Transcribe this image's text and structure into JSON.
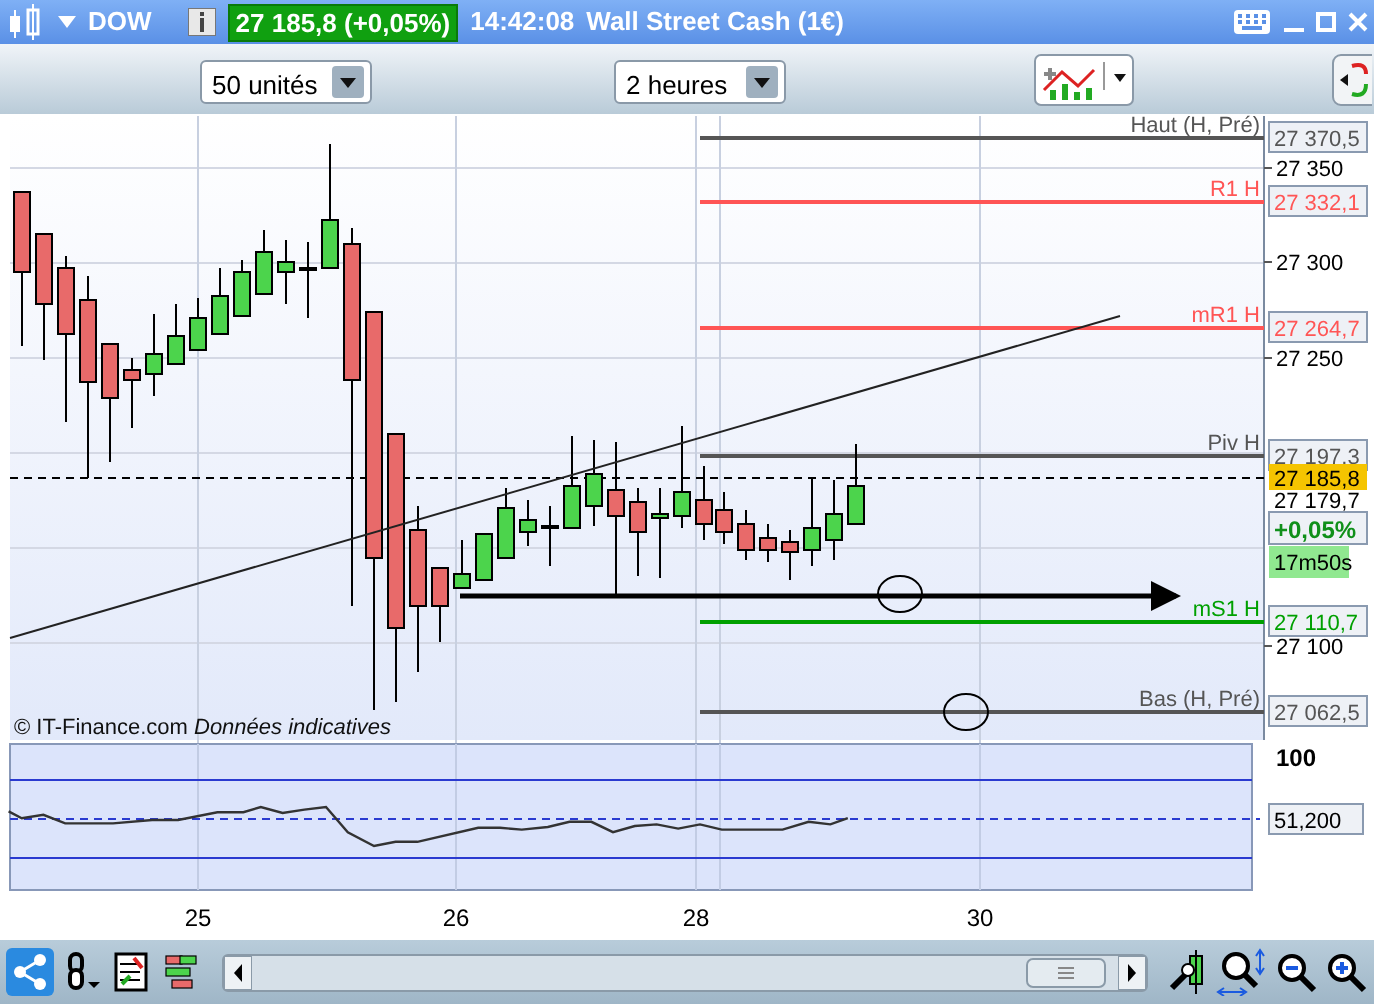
{
  "title_bar": {
    "symbol": "DOW",
    "quote": "27 185,8 (+0,05%)",
    "time": "14:42:08",
    "instrument": "Wall Street Cash (1€)"
  },
  "toolbar": {
    "selects": [
      {
        "value": "50 unités"
      },
      {
        "value": "2 heures"
      }
    ]
  },
  "chart": {
    "y_ticks": [
      "27 350",
      "27 300",
      "27 250",
      "27 100"
    ],
    "levels": [
      {
        "name": "Haut (H, Pré)",
        "value": "27 370,5",
        "color": "#555555"
      },
      {
        "name": "R1 H",
        "value": "27 332,1",
        "color": "#ff5555"
      },
      {
        "name": "mR1 H",
        "value": "27 264,7",
        "color": "#ff5555"
      },
      {
        "name": "Piv H",
        "value": "27 197,3",
        "color": "#555555"
      },
      {
        "name": "mS1 H",
        "value": "27 110,7",
        "color": "#00a000"
      },
      {
        "name": "Bas (H, Pré)",
        "value": "27 062,5",
        "color": "#555555"
      }
    ],
    "price_tags": [
      {
        "kind": "current",
        "text": "27 185,8"
      },
      {
        "kind": "plain",
        "text": "27 179,7"
      },
      {
        "kind": "change",
        "text": "+0,05%"
      },
      {
        "kind": "timer",
        "text": "17m50s"
      }
    ],
    "copyright": "© IT-Finance.com",
    "note": "Données indicatives"
  },
  "indicator": {
    "top_label": "100",
    "value": "51,200"
  },
  "x_axis": [
    "25",
    "26",
    "28",
    "30"
  ]
}
